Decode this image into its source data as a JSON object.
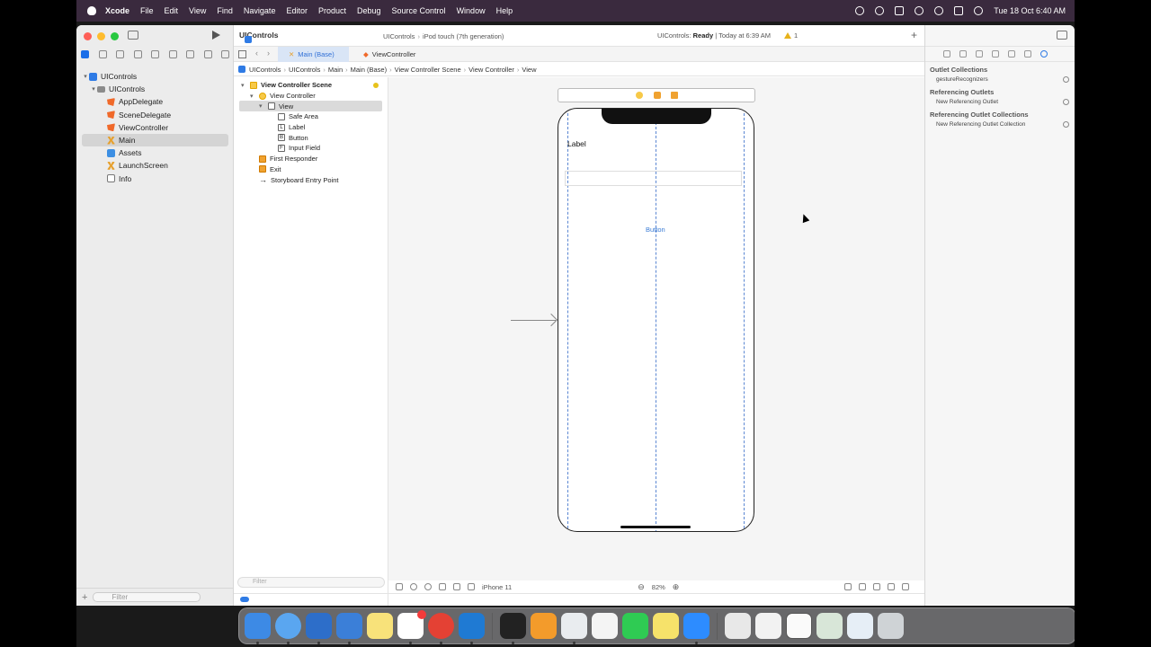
{
  "menubar": {
    "app": "Xcode",
    "items": [
      "File",
      "Edit",
      "View",
      "Find",
      "Navigate",
      "Editor",
      "Product",
      "Debug",
      "Source Control",
      "Window",
      "Help"
    ],
    "clock": "Tue 18 Oct  6:40 AM"
  },
  "toolbar": {
    "project": "UIControls",
    "scheme": "UIControls",
    "destination": "iPod touch (7th generation)",
    "status_prefix": "UIControls: ",
    "status_bold": "Ready",
    "status_suffix": " | Today at 6:39 AM",
    "warnings": "1"
  },
  "tabs": [
    "Main (Base)",
    "ViewController"
  ],
  "breadcrumb": [
    "UIControls",
    "UIControls",
    "Main",
    "Main (Base)",
    "View Controller Scene",
    "View Controller",
    "View"
  ],
  "navigator": {
    "items": [
      {
        "label": "UIControls",
        "icon": "project-icon",
        "level": 0
      },
      {
        "label": "UIControls",
        "icon": "folder-icon",
        "level": 1
      },
      {
        "label": "AppDelegate",
        "icon": "swift-file-icon",
        "level": 2
      },
      {
        "label": "SceneDelegate",
        "icon": "swift-file-icon",
        "level": 2
      },
      {
        "label": "ViewController",
        "icon": "swift-file-icon",
        "level": 2
      },
      {
        "label": "Main",
        "icon": "storyboard-icon",
        "level": 2,
        "selected": true
      },
      {
        "label": "Assets",
        "icon": "assets-icon",
        "level": 2
      },
      {
        "label": "LaunchScreen",
        "icon": "storyboard-icon",
        "level": 2
      },
      {
        "label": "Info",
        "icon": "plist-icon",
        "level": 2
      }
    ],
    "filter_placeholder": "Filter"
  },
  "outline": {
    "items": [
      {
        "label": "View Controller Scene",
        "level": 0
      },
      {
        "label": "View Controller",
        "level": 1
      },
      {
        "label": "View",
        "level": 2
      },
      {
        "label": "Safe Area",
        "level": 3
      },
      {
        "label": "Label",
        "level": 3,
        "glyph": "L"
      },
      {
        "label": "Button",
        "level": 3,
        "glyph": "B"
      },
      {
        "label": "Input Field",
        "level": 3,
        "glyph": "F"
      },
      {
        "label": "First Responder",
        "level": 1
      },
      {
        "label": "Exit",
        "level": 1
      },
      {
        "label": "Storyboard Entry Point",
        "level": 1
      }
    ],
    "filter_placeholder": "Filter"
  },
  "canvas": {
    "label_text": "Label",
    "button_text": "Button",
    "device": "iPhone 11",
    "zoom": "82%"
  },
  "inspector": {
    "sections": [
      {
        "title": "Outlet Collections",
        "rows": [
          "gestureRecognizers"
        ]
      },
      {
        "title": "Referencing Outlets",
        "rows": [
          "New Referencing Outlet"
        ]
      },
      {
        "title": "Referencing Outlet Collections",
        "rows": [
          "New Referencing Outlet Collection"
        ]
      }
    ]
  },
  "dock": {
    "apps": [
      "finder-icon",
      "safari-icon",
      "xcode-icon",
      "simulator-icon",
      "notes-icon",
      "slack-icon",
      "chrome-icon",
      "vscode-icon",
      "terminal-icon",
      "pages-icon",
      "preview-icon",
      "textedit-icon",
      "whatsapp-icon",
      "stickies-icon",
      "zoom-icon",
      "document-icon",
      "document-icon",
      "document-icon",
      "document-icon",
      "document-icon",
      "trash-icon"
    ]
  }
}
